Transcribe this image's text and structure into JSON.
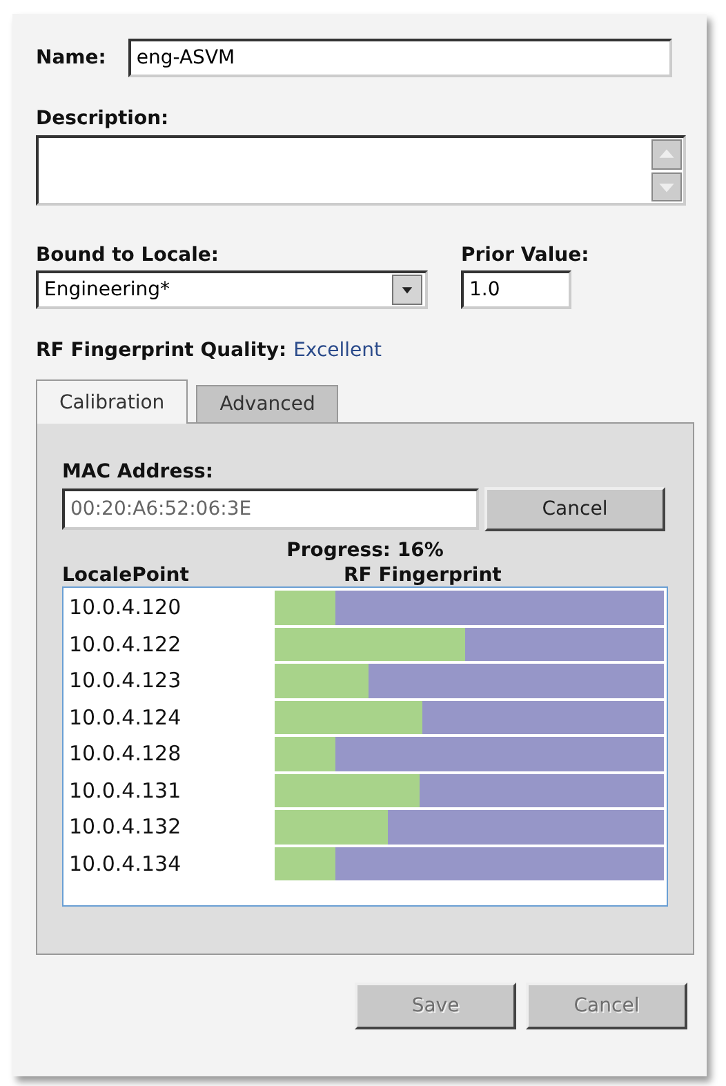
{
  "name": {
    "label": "Name:",
    "value": "eng-ASVM"
  },
  "description": {
    "label": "Description:"
  },
  "locale": {
    "label": "Bound to Locale:",
    "value": "Engineering*"
  },
  "prior": {
    "label": "Prior Value:",
    "value": "1.0"
  },
  "quality": {
    "label": "RF Fingerprint Quality:",
    "value": "Excellent"
  },
  "tabs": [
    {
      "label": "Calibration",
      "selected": true
    },
    {
      "label": "Advanced",
      "selected": false
    }
  ],
  "mac": {
    "label": "MAC Address:",
    "value": "00:20:A6:52:06:3E",
    "disabled": true,
    "button": "Cancel"
  },
  "progress": "Progress:  16%",
  "table": {
    "columns": [
      "LocalePoint",
      "RF Fingerprint"
    ],
    "rows": [
      {
        "point": "10.0.4.120",
        "level": 0.156
      },
      {
        "point": "10.0.4.122",
        "level": 0.49
      },
      {
        "point": "10.0.4.123",
        "level": 0.24
      },
      {
        "point": "10.0.4.124",
        "level": 0.38
      },
      {
        "point": "10.0.4.128",
        "level": 0.156
      },
      {
        "point": "10.0.4.131",
        "level": 0.37
      },
      {
        "point": "10.0.4.132",
        "level": 0.29
      },
      {
        "point": "10.0.4.134",
        "level": 0.156
      }
    ]
  },
  "buttons": [
    {
      "label": "Save",
      "disabled": true
    },
    {
      "label": "Cancel",
      "disabled": true
    }
  ]
}
